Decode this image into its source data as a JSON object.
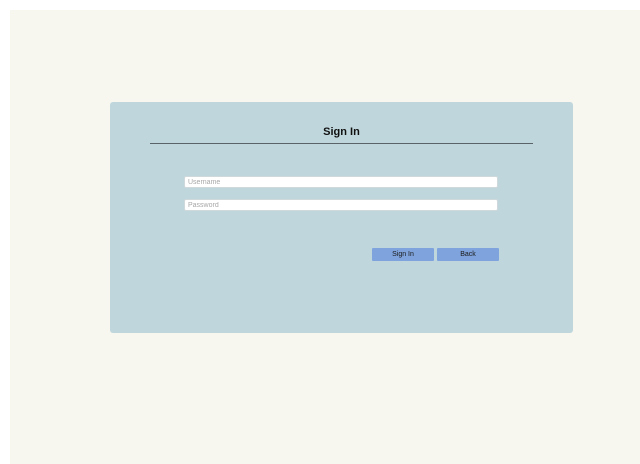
{
  "login": {
    "title": "Sign In",
    "username_placeholder": "Username",
    "password_placeholder": "Password",
    "username_value": "",
    "password_value": "",
    "signin_label": "Sign In",
    "back_label": "Back"
  },
  "colors": {
    "page_background": "#f7f6ef",
    "card_background": "#bfd7dc",
    "button_background": "#7fa3dc",
    "divider": "#5a6468"
  }
}
